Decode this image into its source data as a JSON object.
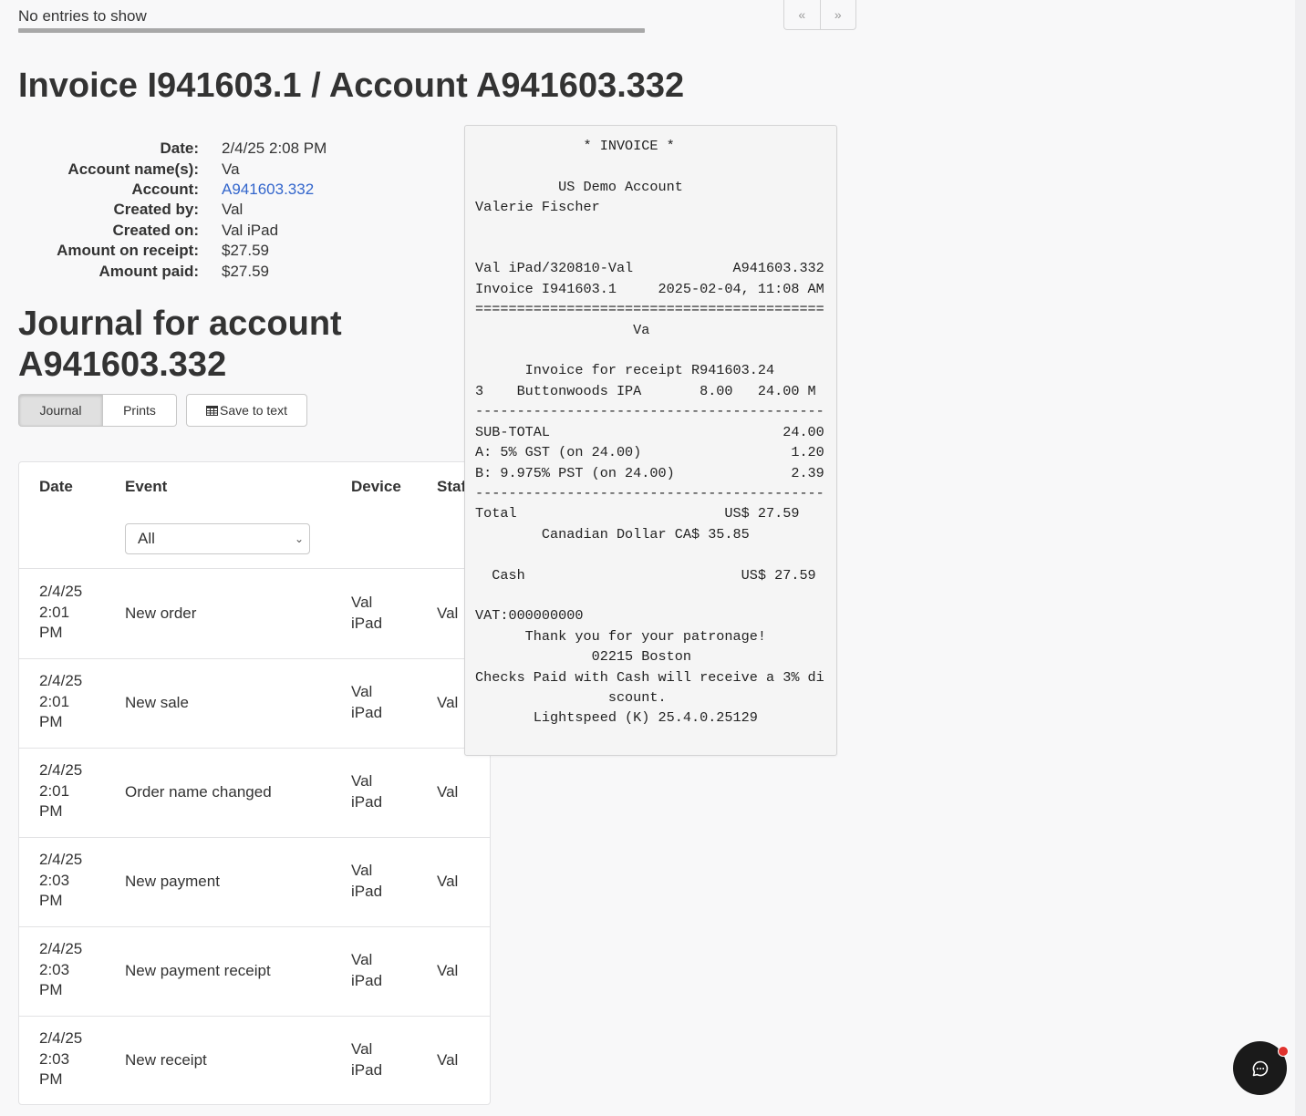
{
  "top": {
    "no_entries": "No entries to show",
    "pager_prev": "«",
    "pager_next": "»"
  },
  "invoice": {
    "title": "Invoice I941603.1 / Account A941603.332",
    "fields": [
      {
        "label": "Date:",
        "value": "2/4/25 2:08 PM"
      },
      {
        "label": "Account name(s):",
        "value": "Va"
      },
      {
        "label": "Account:",
        "value": "A941603.332"
      },
      {
        "label": "Created by:",
        "value": "Val"
      },
      {
        "label": "Created on:",
        "value": "Val iPad"
      },
      {
        "label": "Amount on receipt:",
        "value": "$27.59"
      },
      {
        "label": "Amount paid:",
        "value": "$27.59"
      }
    ]
  },
  "journal": {
    "title_line1": "Journal for account",
    "title_line2": "A941603.332",
    "tabs": {
      "journal": "Journal",
      "prints": "Prints"
    },
    "save_label": "Save to text",
    "columns": {
      "date": "Date",
      "event": "Event",
      "device": "Device",
      "staff": "Staff"
    },
    "event_filter": "All",
    "rows": [
      {
        "date_1": "2/4/25",
        "date_2": "2:01",
        "date_3": "PM",
        "event": "New order",
        "device_1": "Val",
        "device_2": "iPad",
        "staff": "Val"
      },
      {
        "date_1": "2/4/25",
        "date_2": "2:01",
        "date_3": "PM",
        "event": "New sale",
        "device_1": "Val",
        "device_2": "iPad",
        "staff": "Val"
      },
      {
        "date_1": "2/4/25",
        "date_2": "2:01",
        "date_3": "PM",
        "event": "Order name changed",
        "device_1": "Val",
        "device_2": "iPad",
        "staff": "Val"
      },
      {
        "date_1": "2/4/25",
        "date_2": "2:03",
        "date_3": "PM",
        "event": "New payment",
        "device_1": "Val",
        "device_2": "iPad",
        "staff": "Val"
      },
      {
        "date_1": "2/4/25",
        "date_2": "2:03",
        "date_3": "PM",
        "event": "New payment receipt",
        "device_1": "Val",
        "device_2": "iPad",
        "staff": "Val"
      },
      {
        "date_1": "2/4/25",
        "date_2": "2:03",
        "date_3": "PM",
        "event": "New receipt",
        "device_1": "Val",
        "device_2": "iPad",
        "staff": "Val"
      }
    ]
  },
  "receipt": {
    "text": "             * INVOICE *\n\n          US Demo Account\nValerie Fischer\n\n\nVal iPad/320810-Val            A941603.332\nInvoice I941603.1     2025-02-04, 11:08 AM\n==========================================\n                   Va\n\n      Invoice for receipt R941603.24\n3    Buttonwoods IPA       8.00   24.00 M\n------------------------------------------\nSUB-TOTAL                            24.00\nA: 5% GST (on 24.00)                  1.20\nB: 9.975% PST (on 24.00)              2.39\n------------------------------------------\nTotal                         US$ 27.59\n        Canadian Dollar CA$ 35.85\n\n  Cash                          US$ 27.59\n\nVAT:000000000\n      Thank you for your patronage!\n              02215 Boston\nChecks Paid with Cash will receive a 3% di\n                scount.\n       Lightspeed (K) 25.4.0.25129"
  },
  "colors": {
    "link": "#3366cc",
    "chat_bubble": "#1a1a1a",
    "notification_dot": "#e0332e"
  }
}
